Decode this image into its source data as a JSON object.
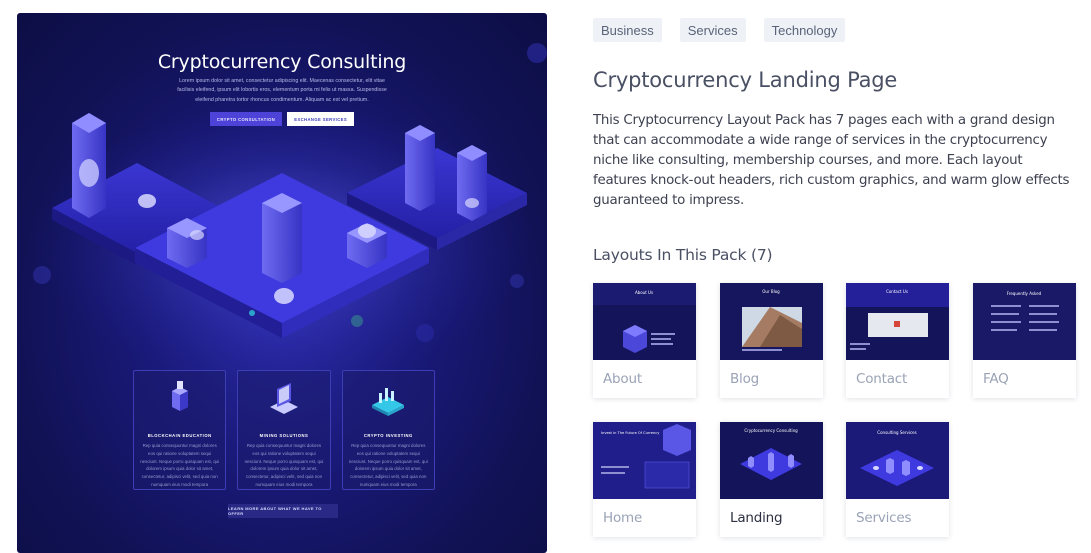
{
  "preview": {
    "hero_title": "Cryptocurrency Consulting",
    "hero_desc": "Lorem ipsum dolor sit amet, consectetur adipiscing elit. Maecenas consectetur, elit vitae facilisis eleifend, ipsum elit lobortis eros, elementum porta mi felis ut massa. Suspendisse eleifend pharetra tortor rhoncus condimentum. Aliquam ac est vel pretium.",
    "btn_primary": "CRYPTO CONSULTATION",
    "btn_secondary": "EXCHANGE SERVICES",
    "cards": [
      {
        "title": "BLOCKCHAIN EDUCATION",
        "icon": "blockchain-icon",
        "text": "Rep quia consequuntur magni dolores eos qui ratione voluptatem sequi nesciunt. Neque porro quisquam est, qui dolorem ipsum quia dolor sit amet, consectetur, adipisci velit, sed quia non numquam eius modi tempora"
      },
      {
        "title": "MINING SOLUTIONS",
        "icon": "laptop-mining-icon",
        "text": "Rep quia consequuntur magni dolores eos qui ratione voluptatem sequi nesciunt. Neque porro quisquam est, qui dolorem ipsum quia dolor sit amet, consectetur, adipisci velit, sed quia non numquam eius modi tempora"
      },
      {
        "title": "CRYPTO INVESTING",
        "icon": "chart-investing-icon",
        "text": "Rep quia consequuntur magni dolores eos qui ratione voluptatem sequi nesciunt. Neque porro quisquam est, qui dolorem ipsum quia dolor sit amet, consectetur, adipisci velit, sed quia non numquam eius modi tempora"
      }
    ],
    "learn_more": "LEARN MORE ABOUT WHAT WE HAVE TO OFFER"
  },
  "tags": [
    "Business",
    "Services",
    "Technology"
  ],
  "title": "Cryptocurrency Landing Page",
  "description": "This Cryptocurrency Layout Pack has 7 pages each with a grand design that can accommodate a wide range of services in the cryptocurrency niche like consulting, membership courses, and more. Each layout features knock-out headers, rich custom graphics, and warm glow effects guaranteed to impress.",
  "layouts_heading": "Layouts In This Pack (7)",
  "layouts": [
    {
      "label": "About",
      "active": false
    },
    {
      "label": "Blog",
      "active": false
    },
    {
      "label": "Contact",
      "active": false
    },
    {
      "label": "FAQ",
      "active": false
    },
    {
      "label": "Home",
      "active": false
    },
    {
      "label": "Landing",
      "active": true
    },
    {
      "label": "Services",
      "active": false
    }
  ],
  "thumb_texts": {
    "about": "About Us",
    "blog": "Our Blog",
    "contact": "Contact Us",
    "faq": "Frequently Asked",
    "home": "Invest in The Future Of Currency",
    "landing": "Cryptocurrency Consulting",
    "services": "Consulting Services"
  },
  "colors": {
    "accent": "#4e43d8",
    "bg_dark": "#111256",
    "tag_bg": "#eef2f7"
  }
}
